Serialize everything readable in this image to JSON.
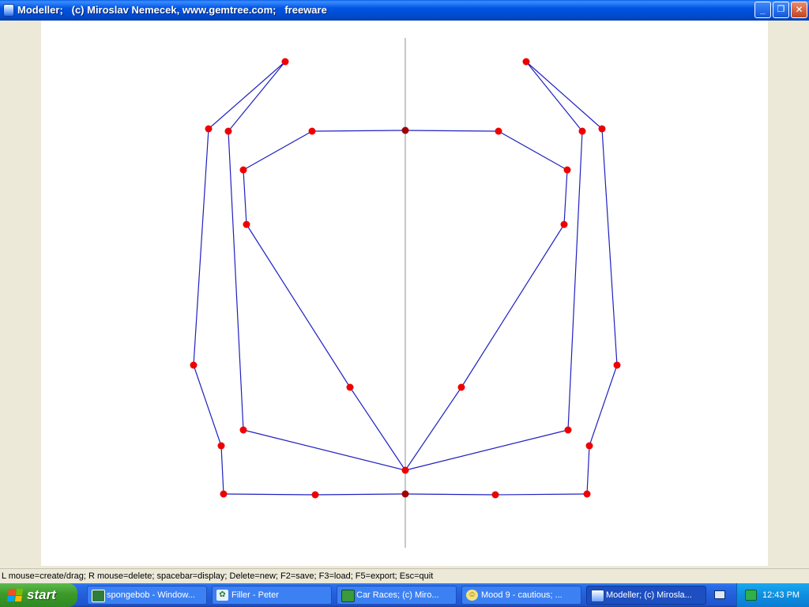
{
  "window": {
    "title": "Modeller;   (c) Miroslav Nemecek, www.gemtree.com;   freeware",
    "buttons": {
      "minimize": "_",
      "maximize": "❐",
      "close": "✕"
    }
  },
  "status_text": "L mouse=create/drag; R mouse=delete; spacebar=display; Delete=new; F2=save; F3=load; F5=export; Esc=quit",
  "colors": {
    "line": "#2020c0",
    "point": "#ee0000",
    "axis_point": "#a00000",
    "axis": "#c8c8c8"
  },
  "taskbar": {
    "start_label": "start",
    "tasks": [
      {
        "label": "spongebob - Window...",
        "icon": "picture-viewer-icon"
      },
      {
        "label": "Filler - Peter",
        "icon": "filler-app-icon"
      },
      {
        "label": "Car Races;   (c) Miro...",
        "icon": "car-races-icon"
      },
      {
        "label": "Mood 9 - cautious;  ...",
        "icon": "smiley-icon"
      },
      {
        "label": "Modeller;   (c) Mirosla...",
        "icon": "modeller-icon",
        "active": true
      }
    ],
    "clock": "12:43 PM"
  }
}
